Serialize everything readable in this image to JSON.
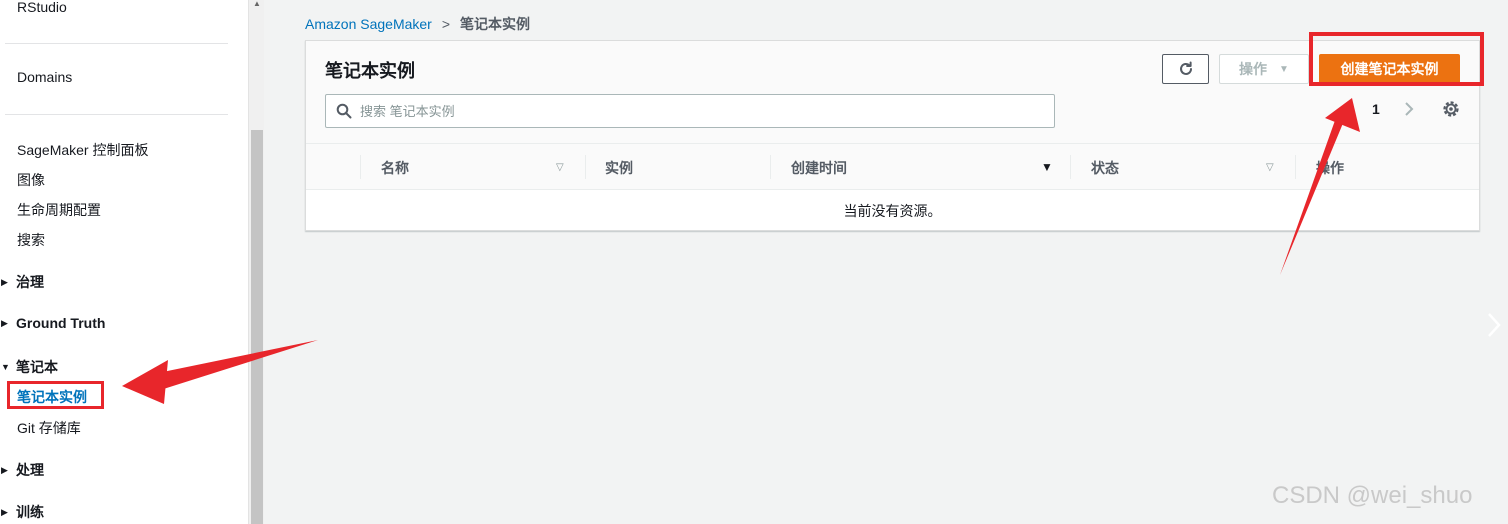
{
  "sidebar": {
    "top_items": [
      "RStudio",
      "Domains"
    ],
    "console_items": [
      "SageMaker 控制面板",
      "图像",
      "生命周期配置",
      "搜索"
    ],
    "sections": [
      {
        "label": "治理",
        "expanded": false
      },
      {
        "label": "Ground Truth",
        "expanded": false
      },
      {
        "label": "笔记本",
        "expanded": true
      },
      {
        "label": "处理",
        "expanded": false
      },
      {
        "label": "训练",
        "expanded": false
      }
    ],
    "notebook_items": [
      {
        "label": "笔记本实例",
        "active": true
      },
      {
        "label": "Git 存储库",
        "active": false
      }
    ]
  },
  "breadcrumb": {
    "parent": "Amazon SageMaker",
    "separator": ">",
    "current": "笔记本实例"
  },
  "panel": {
    "title": "笔记本实例",
    "search_placeholder": "搜索 笔记本实例",
    "actions_label": "操作",
    "create_label": "创建笔记本实例",
    "page_number": "1"
  },
  "table": {
    "columns": [
      "名称",
      "实例",
      "创建时间",
      "状态",
      "操作"
    ],
    "empty_message": "当前没有资源。"
  },
  "watermark": "CSDN @wei_shuo",
  "colors": {
    "primary_orange": "#ec7211",
    "link_blue": "#0073bb",
    "annotation_red": "#e8262b"
  }
}
